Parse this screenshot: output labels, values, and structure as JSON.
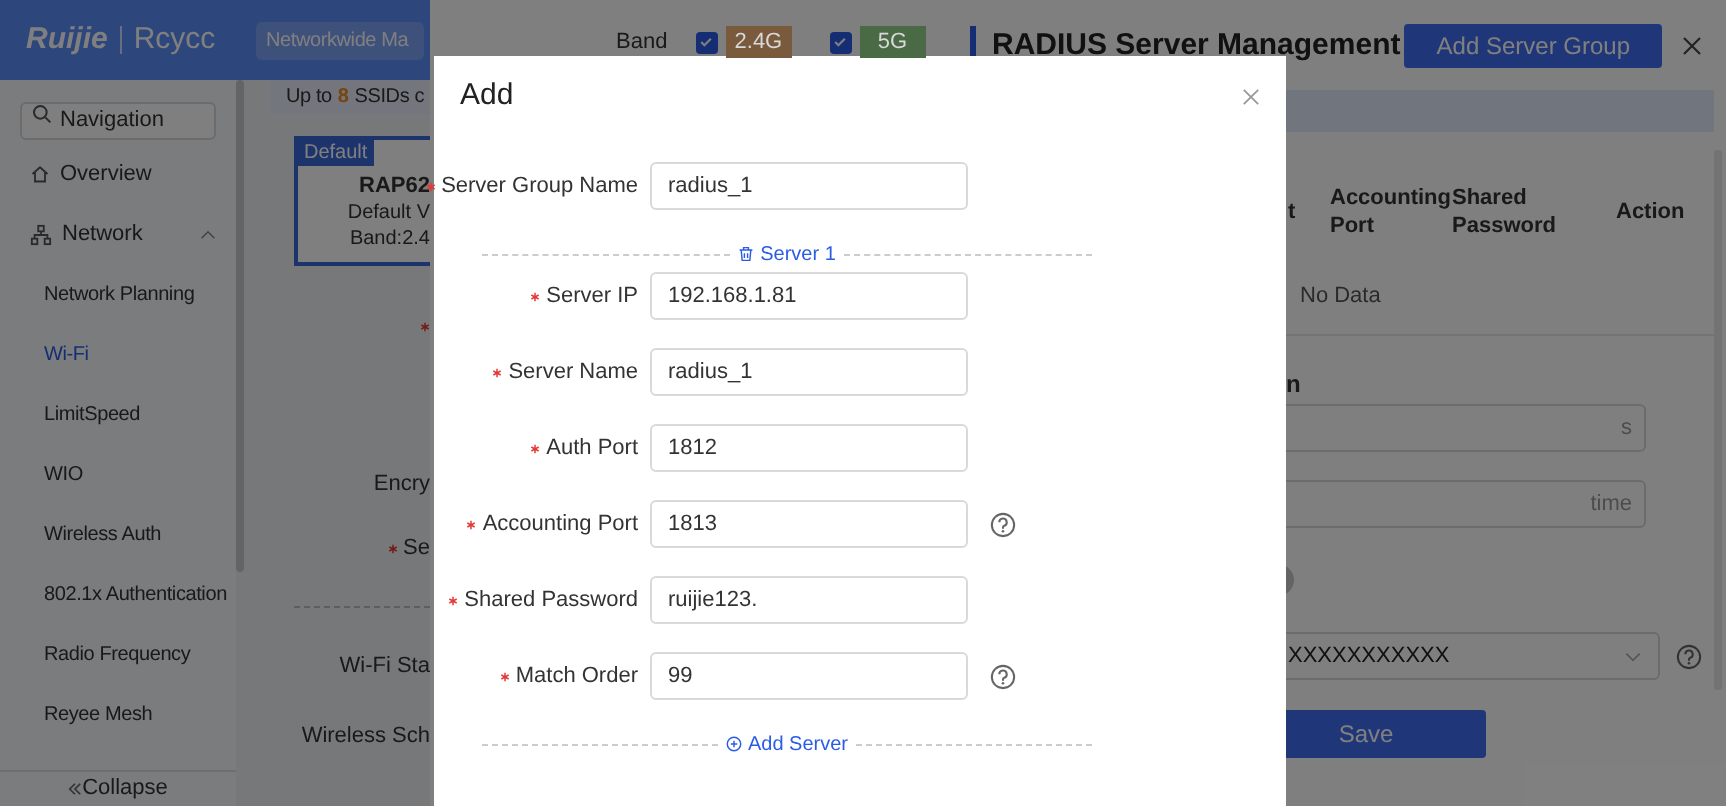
{
  "header": {
    "logo_brand": "Ruijie",
    "logo_product": "Rcycc",
    "scope_select": "Networkwide Ma"
  },
  "sidebar": {
    "search": {
      "placeholder": "Navigation"
    },
    "items": [
      {
        "label": "Overview",
        "selected": false,
        "kind": "home"
      },
      {
        "label": "Network",
        "selected": false,
        "kind": "group",
        "expanded": true,
        "children": [
          {
            "label": "Network Planning",
            "selected": false
          },
          {
            "label": "Wi-Fi",
            "selected": true
          },
          {
            "label": "LimitSpeed",
            "selected": false
          },
          {
            "label": "WIO",
            "selected": false
          },
          {
            "label": "Wireless Auth",
            "selected": false
          },
          {
            "label": "802.1x Authentication",
            "selected": false
          },
          {
            "label": "Radio Frequency",
            "selected": false
          },
          {
            "label": "Reyee Mesh",
            "selected": false
          }
        ]
      }
    ],
    "collapse": "Collapse"
  },
  "main": {
    "banner": {
      "prefix": "Up to",
      "count": "8",
      "suffix": "SSIDs c"
    },
    "card": {
      "tag": "Default",
      "name": "RAP62",
      "lines": [
        "Default V",
        "Band:2.4"
      ]
    },
    "labels": [
      {
        "required": true
      },
      {
        "text": "Encry",
        "required": false
      },
      {
        "text": "Se",
        "required": true
      },
      {
        "kind": "divider"
      },
      {
        "text": "Wi-Fi Sta",
        "required": false
      },
      {
        "text": "Wireless Sch",
        "required": false
      }
    ]
  },
  "wifi_panel": {
    "band": {
      "label": "Band",
      "options": [
        {
          "label": "2.4G",
          "checked": true,
          "color": "#7a5a3c"
        },
        {
          "label": "5G",
          "checked": true,
          "color": "#4a6a45"
        }
      ]
    }
  },
  "drawer": {
    "title": "RADIUS Server Management",
    "add_button": "Add Server Group",
    "table": {
      "columns": [
        "t",
        "Accounting Port",
        "Shared Password",
        "Action"
      ],
      "empty": "No Data"
    },
    "section_label": "n",
    "fields": [
      {
        "kind": "input",
        "suffix": "s"
      },
      {
        "kind": "input",
        "suffix": "time"
      },
      {
        "kind": "toggle",
        "on": false
      },
      {
        "kind": "select",
        "value": "XXXXXXXXXXX",
        "help": true
      }
    ],
    "save": "Save"
  },
  "modal": {
    "title": "Add",
    "rows": [
      {
        "kind": "field",
        "label": "Server Group Name",
        "required": true,
        "value": "radius_1"
      },
      {
        "kind": "server_header",
        "label": "Server 1"
      },
      {
        "kind": "field",
        "label": "Server IP",
        "required": true,
        "value": "192.168.1.81"
      },
      {
        "kind": "field",
        "label": "Server Name",
        "required": true,
        "value": "radius_1"
      },
      {
        "kind": "field",
        "label": "Auth Port",
        "required": true,
        "value": "1812"
      },
      {
        "kind": "field",
        "label": "Accounting Port",
        "required": true,
        "value": "1813",
        "help": true
      },
      {
        "kind": "field",
        "label": "Shared Password",
        "required": true,
        "value": "ruijie123."
      },
      {
        "kind": "field",
        "label": "Match Order",
        "required": true,
        "value": "99",
        "help": true
      },
      {
        "kind": "add_server",
        "label": "Add Server"
      }
    ]
  }
}
